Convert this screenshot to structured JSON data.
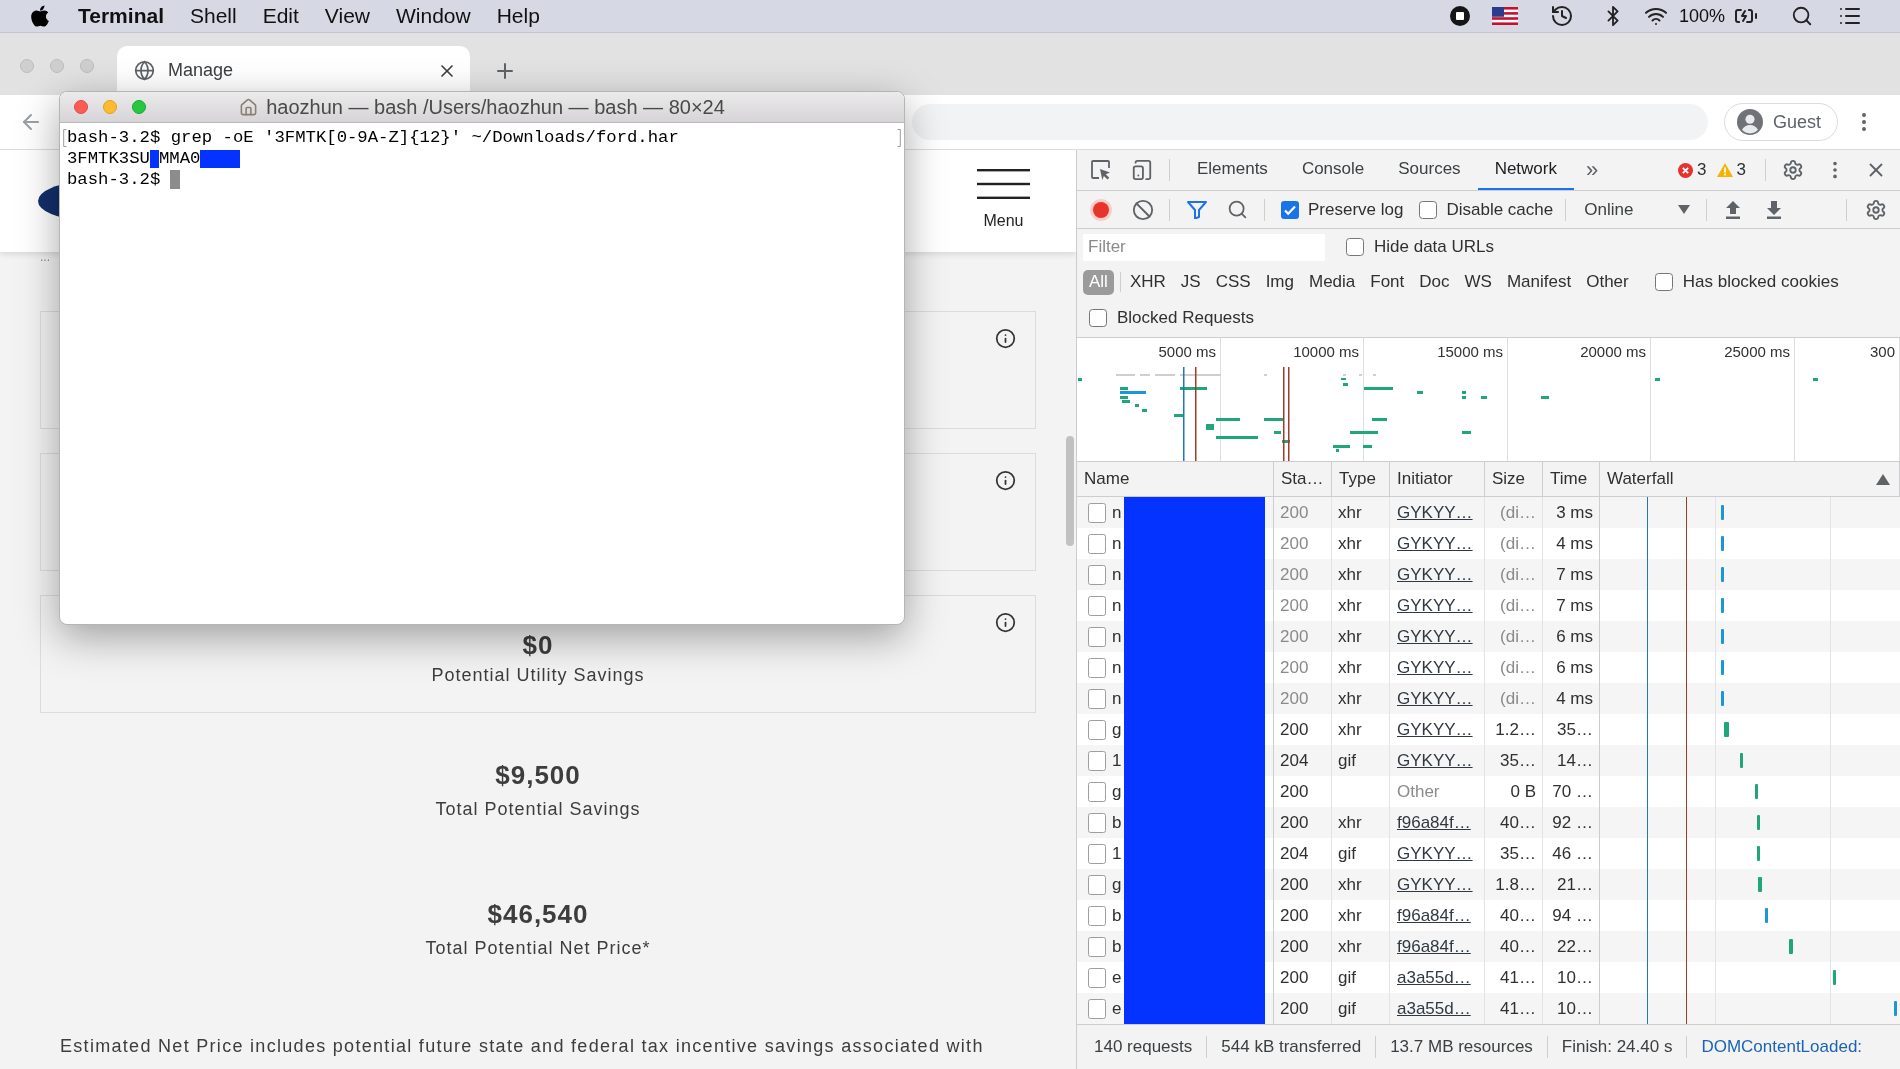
{
  "menu_bar": {
    "app_name": "Terminal",
    "menus": [
      "Shell",
      "Edit",
      "View",
      "Window",
      "Help"
    ],
    "battery": "100%"
  },
  "browser": {
    "tabs": [
      {
        "title": "Manage",
        "selected": true
      }
    ],
    "profile": "Guest"
  },
  "page": {
    "menu_label": "Menu",
    "breadcrumb": "...",
    "cards": [
      {
        "kind": "empty"
      },
      {
        "kind": "empty"
      },
      {
        "kind": "amount",
        "amount": "$0",
        "label": "Potential Utility Savings"
      }
    ],
    "totals": [
      {
        "amount": "$9,500",
        "label": "Total Potential Savings"
      },
      {
        "amount": "$46,540",
        "label": "Total Potential Net Price*"
      }
    ],
    "footnote": "Estimated Net Price includes potential future state and federal tax incentive savings associated with"
  },
  "terminal": {
    "title": "haozhun — bash /Users/haozhun — bash — 80×24",
    "lines": [
      {
        "marked": true,
        "segments": [
          {
            "kind": "text",
            "text": "bash-3.2$ grep -oE '3FMTK[0-9A-Z]{12}' ~/Downloads/ford.har"
          }
        ]
      },
      {
        "marked": false,
        "segments": [
          {
            "kind": "text",
            "text": "3FMTK3SU"
          },
          {
            "kind": "redaction"
          },
          {
            "kind": "text",
            "text": "MMA0"
          },
          {
            "kind": "wide_redaction"
          }
        ]
      },
      {
        "marked": false,
        "segments": [
          {
            "kind": "text",
            "text": "bash-3.2$"
          },
          {
            "kind": "cursor"
          }
        ]
      }
    ]
  },
  "devtools": {
    "tabs": [
      {
        "label": "Elements",
        "selected": false
      },
      {
        "label": "Console",
        "selected": false
      },
      {
        "label": "Sources",
        "selected": false
      },
      {
        "label": "Network",
        "selected": true
      }
    ],
    "more_tabs": "»",
    "issues": {
      "errors": "3",
      "warnings": "3"
    },
    "network_toolbar": {
      "recording": true,
      "preserve_log": {
        "label": "Preserve log",
        "checked": true
      },
      "disable_cache": {
        "label": "Disable cache",
        "checked": false
      },
      "throttling": "Online"
    },
    "filter": {
      "placeholder": "Filter"
    },
    "hide_data_urls": {
      "label": "Hide data URLs",
      "checked": false
    },
    "type_filters": [
      {
        "label": "All",
        "selected": true
      },
      {
        "label": "XHR",
        "selected": false
      },
      {
        "label": "JS",
        "selected": false
      },
      {
        "label": "CSS",
        "selected": false
      },
      {
        "label": "Img",
        "selected": false
      },
      {
        "label": "Media",
        "selected": false
      },
      {
        "label": "Font",
        "selected": false
      },
      {
        "label": "Doc",
        "selected": false
      },
      {
        "label": "WS",
        "selected": false
      },
      {
        "label": "Manifest",
        "selected": false
      },
      {
        "label": "Other",
        "selected": false
      }
    ],
    "has_blocked_cookies": {
      "label": "Has blocked cookies",
      "checked": false
    },
    "blocked_requests": {
      "label": "Blocked Requests",
      "checked": false
    },
    "overview": {
      "tick_labels": [
        "5000 ms",
        "10000 ms",
        "15000 ms",
        "20000 ms",
        "25000 ms",
        "300"
      ]
    },
    "table": {
      "columns": [
        {
          "label": "Name",
          "sorted": false
        },
        {
          "label": "Sta…",
          "sorted": false
        },
        {
          "label": "Type",
          "sorted": false
        },
        {
          "label": "Initiator",
          "sorted": false
        },
        {
          "label": "Size",
          "sorted": false
        },
        {
          "label": "Time",
          "sorted": false
        },
        {
          "label": "Waterfall",
          "sorted": true
        }
      ],
      "rows": [
        {
          "name": "n",
          "status": "200",
          "type": "xhr",
          "initiator": "GYKYY…",
          "initiator_link": true,
          "size": "(di…",
          "time": "3 ms",
          "cached": true
        },
        {
          "name": "n",
          "status": "200",
          "type": "xhr",
          "initiator": "GYKYY…",
          "initiator_link": true,
          "size": "(di…",
          "time": "4 ms",
          "cached": true
        },
        {
          "name": "n",
          "status": "200",
          "type": "xhr",
          "initiator": "GYKYY…",
          "initiator_link": true,
          "size": "(di…",
          "time": "7 ms",
          "cached": true
        },
        {
          "name": "n",
          "status": "200",
          "type": "xhr",
          "initiator": "GYKYY…",
          "initiator_link": true,
          "size": "(di…",
          "time": "7 ms",
          "cached": true
        },
        {
          "name": "n",
          "status": "200",
          "type": "xhr",
          "initiator": "GYKYY…",
          "initiator_link": true,
          "size": "(di…",
          "time": "6 ms",
          "cached": true
        },
        {
          "name": "n",
          "status": "200",
          "type": "xhr",
          "initiator": "GYKYY…",
          "initiator_link": true,
          "size": "(di…",
          "time": "6 ms",
          "cached": true
        },
        {
          "name": "n",
          "status": "200",
          "type": "xhr",
          "initiator": "GYKYY…",
          "initiator_link": true,
          "size": "(di…",
          "time": "4 ms",
          "cached": true
        },
        {
          "name": "g",
          "status": "200",
          "type": "xhr",
          "initiator": "GYKYY…",
          "initiator_link": true,
          "size": "1.2…",
          "time": "35…",
          "cached": false
        },
        {
          "name": "1",
          "status": "204",
          "type": "gif",
          "initiator": "GYKYY…",
          "initiator_link": true,
          "size": "35…",
          "time": "14…",
          "cached": false
        },
        {
          "name": "g",
          "status": "200",
          "initiator": "Other",
          "initiator_link": false,
          "size": "0 B",
          "time": "70 …",
          "cached": false
        },
        {
          "name": "b",
          "status": "200",
          "type": "xhr",
          "initiator": "f96a84f…",
          "initiator_link": true,
          "size": "40…",
          "time": "92 …",
          "cached": false
        },
        {
          "name": "1",
          "status": "204",
          "type": "gif",
          "initiator": "GYKYY…",
          "initiator_link": true,
          "size": "35…",
          "time": "46 …",
          "cached": false
        },
        {
          "name": "g",
          "status": "200",
          "type": "xhr",
          "initiator": "GYKYY…",
          "initiator_link": true,
          "size": "1.8…",
          "time": "21…",
          "cached": false
        },
        {
          "name": "b",
          "status": "200",
          "type": "xhr",
          "initiator": "f96a84f…",
          "initiator_link": true,
          "size": "40…",
          "time": "94 …",
          "cached": false
        },
        {
          "name": "b",
          "status": "200",
          "type": "xhr",
          "initiator": "f96a84f…",
          "initiator_link": true,
          "size": "40…",
          "time": "22…",
          "cached": false
        },
        {
          "name": "e",
          "status": "200",
          "type": "gif",
          "initiator": "a3a55d…",
          "initiator_link": true,
          "size": "41…",
          "time": "10…",
          "cached": false
        },
        {
          "name": "e",
          "status": "200",
          "type": "gif",
          "initiator": "a3a55d…",
          "initiator_link": true,
          "size": "41…",
          "time": "10…",
          "cached": false
        }
      ]
    },
    "status_bar": [
      {
        "kind": "stat",
        "text": "140 requests"
      },
      {
        "kind": "stat",
        "text": "544 kB transferred"
      },
      {
        "kind": "stat",
        "text": "13.7 MB resources"
      },
      {
        "kind": "stat",
        "text": "Finish: 24.40 s"
      },
      {
        "kind": "event",
        "text": "DOMContentLoaded:"
      }
    ]
  }
}
